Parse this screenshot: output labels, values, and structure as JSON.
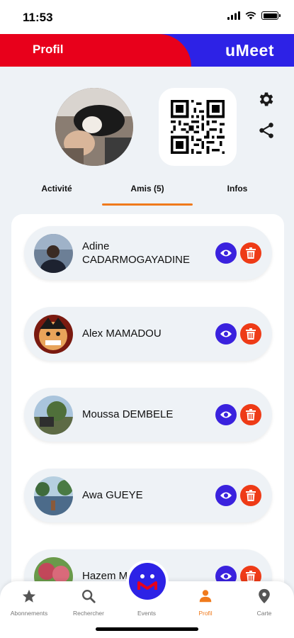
{
  "status_bar": {
    "time": "11:53"
  },
  "header": {
    "title": "Profil",
    "logo": "uMeet"
  },
  "profile": {
    "actions": {
      "settings_icon": "gear-icon",
      "share_icon": "share-icon"
    }
  },
  "tabs": [
    {
      "label": "Activité",
      "active": false
    },
    {
      "label": "Amis (5)",
      "active": true
    },
    {
      "label": "Infos",
      "active": false
    }
  ],
  "friends": [
    {
      "name": "Adine\nCADARMOGAYADINE"
    },
    {
      "name": "Alex MAMADOU"
    },
    {
      "name": "Moussa DEMBELE"
    },
    {
      "name": "Awa GUEYE"
    },
    {
      "name": "Hazem M"
    }
  ],
  "bottom_nav": [
    {
      "label": "Abonnements",
      "icon": "star-icon",
      "active": false
    },
    {
      "label": "Rechercher",
      "icon": "search-icon",
      "active": false
    },
    {
      "label": "Events",
      "icon": "events-logo-icon",
      "active": false
    },
    {
      "label": "Profil",
      "icon": "user-icon",
      "active": true
    },
    {
      "label": "Carte",
      "icon": "map-pin-icon",
      "active": false
    }
  ],
  "colors": {
    "brand_red": "#e8001b",
    "brand_blue": "#2d22e6",
    "accent_orange": "#f07a1c",
    "delete_red": "#ee3b17",
    "view_blue": "#3a22de"
  }
}
